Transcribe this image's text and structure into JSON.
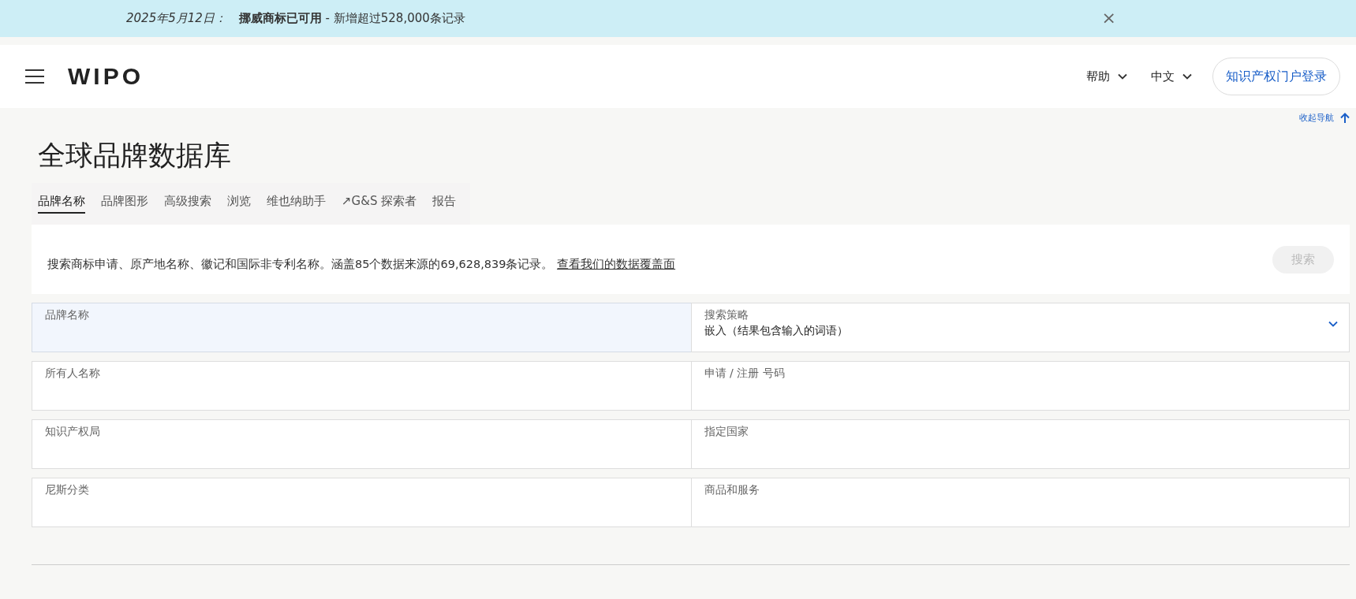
{
  "banner": {
    "date": "2025年5月12日：",
    "message": "**挪威商标已可用** - 新增超过528,000条记录",
    "close": "×"
  },
  "header": {
    "logo": "WIPO",
    "menus": [
      {
        "label": "帮助"
      },
      {
        "label": "中文"
      }
    ],
    "login": "知识产权门户登录"
  },
  "collapse_nav": "收起导航",
  "title": "全球品牌数据库",
  "tabs": [
    {
      "label": "品牌名称",
      "selected": true
    },
    {
      "label": "品牌图形",
      "selected": false
    },
    {
      "label": "高级搜索",
      "selected": false
    },
    {
      "label": "浏览",
      "selected": false
    },
    {
      "label": "维也纳助手",
      "selected": false
    },
    {
      "label": "↗G&S 探索者",
      "selected": false
    },
    {
      "label": "报告",
      "selected": false
    }
  ],
  "intro": {
    "text": "搜索商标申请、原产地名称、徽记和国际非专利名称。涵盖85个数据来源的69,628,839条记录。",
    "link": "查看我们的数据覆盖面",
    "search_button": "搜索",
    "search_disabled": true
  },
  "fields": [
    {
      "kind": "text",
      "label": "品牌名称",
      "focused": true
    },
    {
      "kind": "select",
      "label": "搜索策略",
      "value": "嵌入（结果包含输入的词语）",
      "focused": false
    },
    {
      "kind": "text",
      "label": "所有人名称",
      "focused": false
    },
    {
      "kind": "text",
      "label": "申请 / 注册 号码",
      "focused": false
    },
    {
      "kind": "text",
      "label": "知识产权局",
      "focused": false
    },
    {
      "kind": "text",
      "label": "指定国家",
      "focused": false
    },
    {
      "kind": "text",
      "label": "尼斯分类",
      "focused": false
    },
    {
      "kind": "text",
      "label": "商品和服务",
      "focused": false
    }
  ]
}
